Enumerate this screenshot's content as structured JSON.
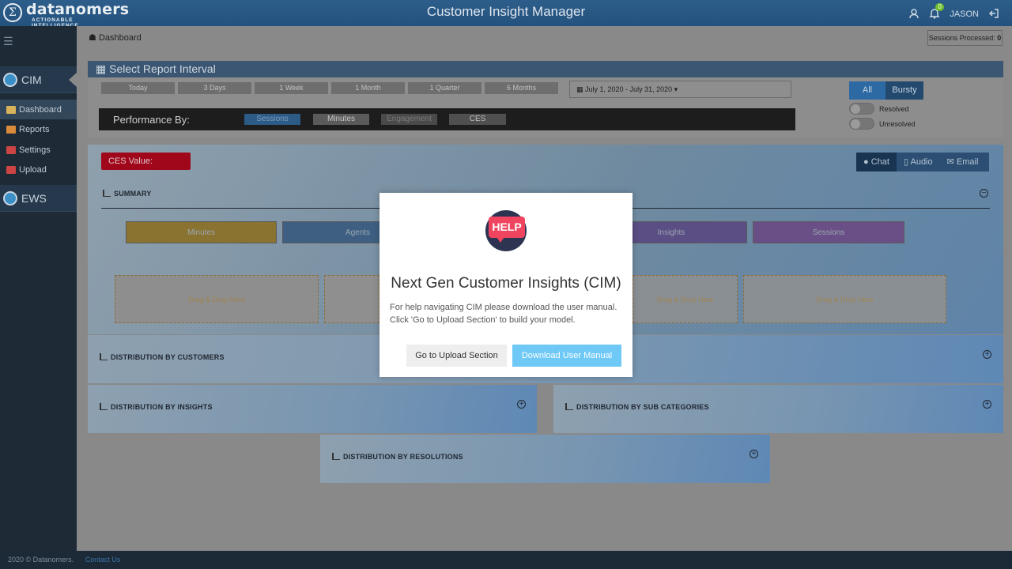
{
  "header": {
    "logo_mark": "Σ",
    "logo_name": "datanomers",
    "logo_tagline": "ACTIONABLE INTELLIGENCE",
    "title": "Customer Insight Manager",
    "notification_count": "0",
    "user": "JASON"
  },
  "sidebar": {
    "sections": [
      {
        "label": "CIM"
      },
      {
        "label": "EWS"
      }
    ],
    "items": [
      {
        "label": "Dashboard",
        "color": "#d9b35a"
      },
      {
        "label": "Reports",
        "color": "#d98a3a"
      },
      {
        "label": "Settings",
        "color": "#c44"
      },
      {
        "label": "Upload",
        "color": "#c44"
      }
    ]
  },
  "breadcrumb": {
    "label": "Dashboard"
  },
  "sessions_processed": {
    "label": "Sessions Processed:",
    "value": "0"
  },
  "interval": {
    "title": "Select Report Interval",
    "buttons": [
      "Today",
      "3 Days",
      "1 Week",
      "1 Month",
      "1 Quarter",
      "6 Months"
    ],
    "date_range": "July 1, 2020 - July 31, 2020"
  },
  "performance": {
    "label": "Performance By:",
    "options": [
      "Sessions",
      "Minutes",
      "Engagement",
      "CES"
    ]
  },
  "filters": {
    "all": "All",
    "bursty": "Bursty",
    "toggles": [
      "Resolved",
      "Unresolved"
    ]
  },
  "ces": {
    "label": "CES Value:"
  },
  "media_tabs": [
    "Chat",
    "Audio",
    "Email"
  ],
  "summary": {
    "title": "SUMMARY",
    "metrics": [
      "Minutes",
      "Agents",
      "Insights",
      "Sessions"
    ],
    "dropzones": [
      "Drag & Drop Here",
      "Drag & Drop Here",
      "Drag & Drop Here"
    ]
  },
  "distributions": {
    "customers": "DISTRIBUTION BY CUSTOMERS",
    "insights": "DISTRIBUTION BY INSIGHTS",
    "sub_categories": "DISTRIBUTION BY SUB CATEGORIES",
    "resolutions": "DISTRIBUTION BY RESOLUTIONS"
  },
  "footer": {
    "copyright": "2020 © Datanomers.",
    "contact": "Contact Us"
  },
  "modal": {
    "badge": "HELP",
    "title": "Next Gen Customer Insights (CIM)",
    "line1": "For help navigating CIM please download the user manual.",
    "line2": "Click 'Go to Upload Section' to build your model.",
    "upload_button": "Go to Upload Section",
    "download_button": "Download User Manual"
  }
}
